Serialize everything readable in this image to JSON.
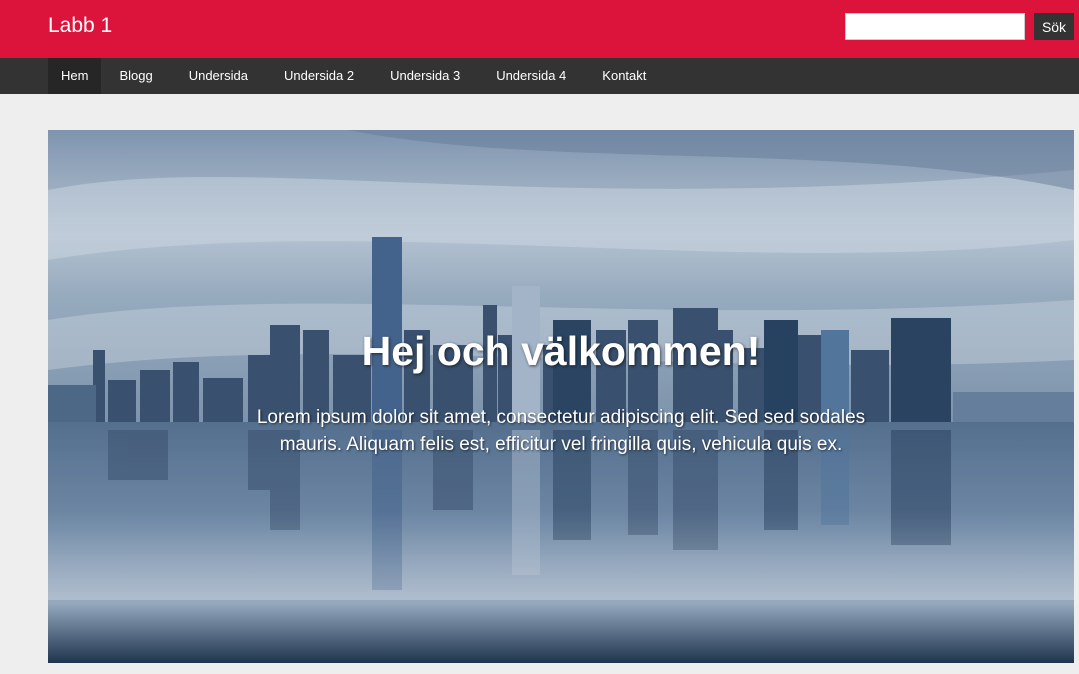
{
  "header": {
    "site_title": "Labb 1",
    "search_placeholder": "",
    "search_value": "",
    "search_button_label": "Sök",
    "brand_color": "#dc143c"
  },
  "nav": {
    "items": [
      {
        "label": "Hem",
        "active": true
      },
      {
        "label": "Blogg",
        "active": false
      },
      {
        "label": "Undersida",
        "active": false
      },
      {
        "label": "Undersida 2",
        "active": false
      },
      {
        "label": "Undersida 3",
        "active": false
      },
      {
        "label": "Undersida 4",
        "active": false
      },
      {
        "label": "Kontakt",
        "active": false
      }
    ],
    "background_color": "#333333"
  },
  "hero": {
    "title": "Hej och välkommen!",
    "text": "Lorem ipsum dolor sit amet, consectetur adipiscing elit. Sed sed sodales mauris. Aliquam felis est, efficitur vel fringilla quis, vehicula quis ex.",
    "image_subject": "city-skyline-reflection-image"
  }
}
